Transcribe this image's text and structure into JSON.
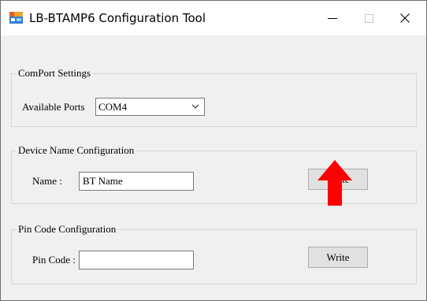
{
  "window": {
    "title": "LB-BTAMP6 Configuration Tool"
  },
  "comport": {
    "group_label": "ComPort Settings",
    "ports_label": "Available Ports",
    "selected_port": "COM4"
  },
  "device_name": {
    "group_label": "Device Name Configuration",
    "name_label": "Name :",
    "name_value": "BT Name",
    "write_label": "Write"
  },
  "pin_code": {
    "group_label": "Pin Code Configuration",
    "pin_label": "Pin Code :",
    "pin_value": "",
    "write_label": "Write"
  },
  "colors": {
    "arrow": "#ff0000",
    "accent": "#0078d7"
  },
  "icons": [
    "app-icon",
    "minimize-icon",
    "maximize-icon",
    "close-icon",
    "chevron-down-icon",
    "red-up-arrow"
  ]
}
